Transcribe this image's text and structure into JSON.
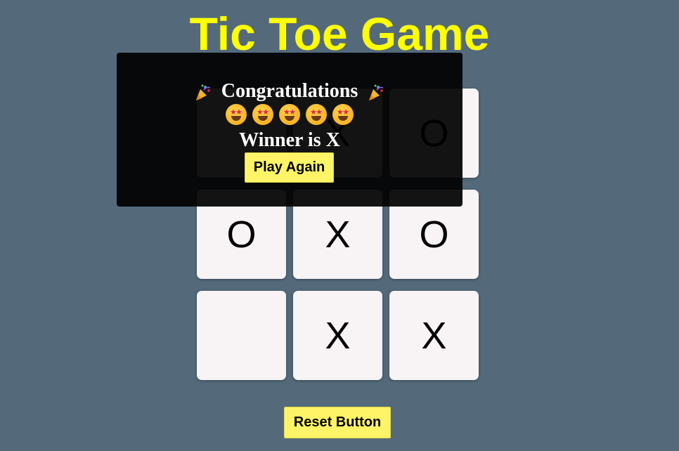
{
  "title": "Tic Toe Game",
  "colors": {
    "background": "#546a7b",
    "title": "#ffff00",
    "cell": "#f8f3f4",
    "button": "#fff467",
    "overlay": "#000000"
  },
  "board": {
    "cells": [
      "",
      "X",
      "O",
      "O",
      "X",
      "O",
      "",
      "X",
      "X"
    ]
  },
  "winner_popup": {
    "congrats_text": "Congratulations",
    "party_icon": "party-popper-icon",
    "emoji_icon": "star-struck-face-icon",
    "emoji_count": 5,
    "winner_text": "Winner is X",
    "play_again_label": "Play Again"
  },
  "reset_label": "Reset Button"
}
